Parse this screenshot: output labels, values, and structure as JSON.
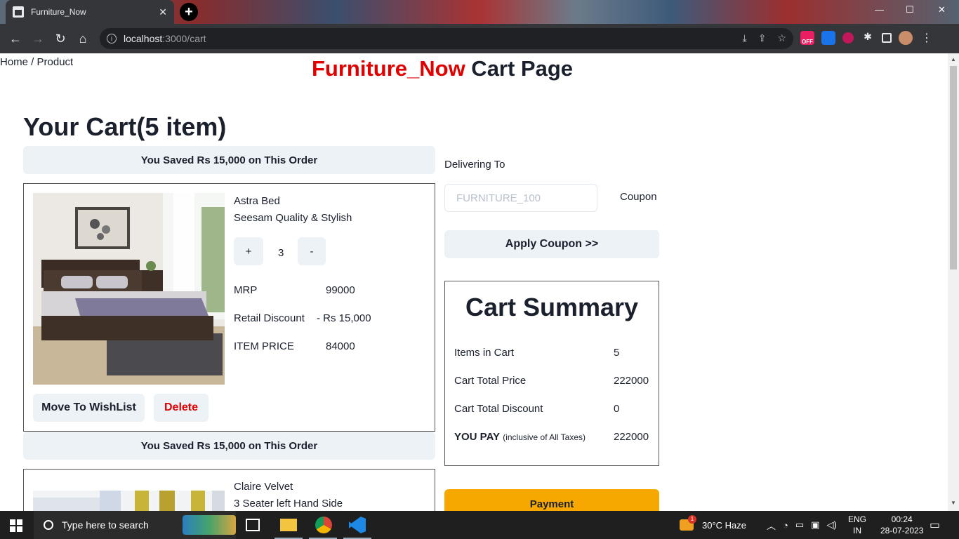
{
  "browser": {
    "tab_title": "Furniture_Now",
    "tab_close": "✕",
    "url_host": "localhost",
    "url_path": ":3000/cart",
    "ext_off_label": "OFF"
  },
  "page": {
    "breadcrumb": "Home / Product",
    "brand": "Furniture_Now",
    "heading_suffix": " Cart Page",
    "cart_title": "Your Cart(5 item)"
  },
  "items": [
    {
      "saved": "You Saved Rs 15,000 on This Order",
      "name": "Astra Bed",
      "desc": "Seesam Quality & Stylish",
      "qty_plus": "+",
      "qty": "3",
      "qty_minus": "-",
      "mrp_label": "MRP",
      "mrp": "99000",
      "discount_label": "Retail Discount",
      "discount": "- Rs 15,000",
      "price_label": "ITEM PRICE",
      "price": "84000",
      "wishlist": "Move To WishList",
      "delete": "Delete"
    },
    {
      "saved": "You Saved Rs 15,000 on This Order",
      "name": "Claire Velvet",
      "desc": "3 Seater left Hand Side"
    }
  ],
  "checkout": {
    "delivering": "Delivering To",
    "coupon_placeholder": "FURNITURE_100",
    "coupon_label": "Coupon",
    "apply": "Apply Coupon >>",
    "payment": "Payment"
  },
  "summary": {
    "title": "Cart Summary",
    "items_label": "Items in Cart",
    "items": "5",
    "total_label": "Cart Total Price",
    "total": "222000",
    "discount_label": "Cart Total Discount",
    "discount": "0",
    "pay_label": "YOU PAY",
    "pay_note": "(inclusive of All Taxes)",
    "pay": "222000"
  },
  "taskbar": {
    "search_placeholder": "Type here to search",
    "weather_badge": "1",
    "weather": "30°C  Haze",
    "lang_top": "ENG",
    "lang_bottom": "IN",
    "time": "00:24",
    "date": "28-07-2023"
  },
  "colors": {
    "brand_red": "#e00000",
    "payment": "#f6a700",
    "button_bg": "#edf2f7"
  }
}
